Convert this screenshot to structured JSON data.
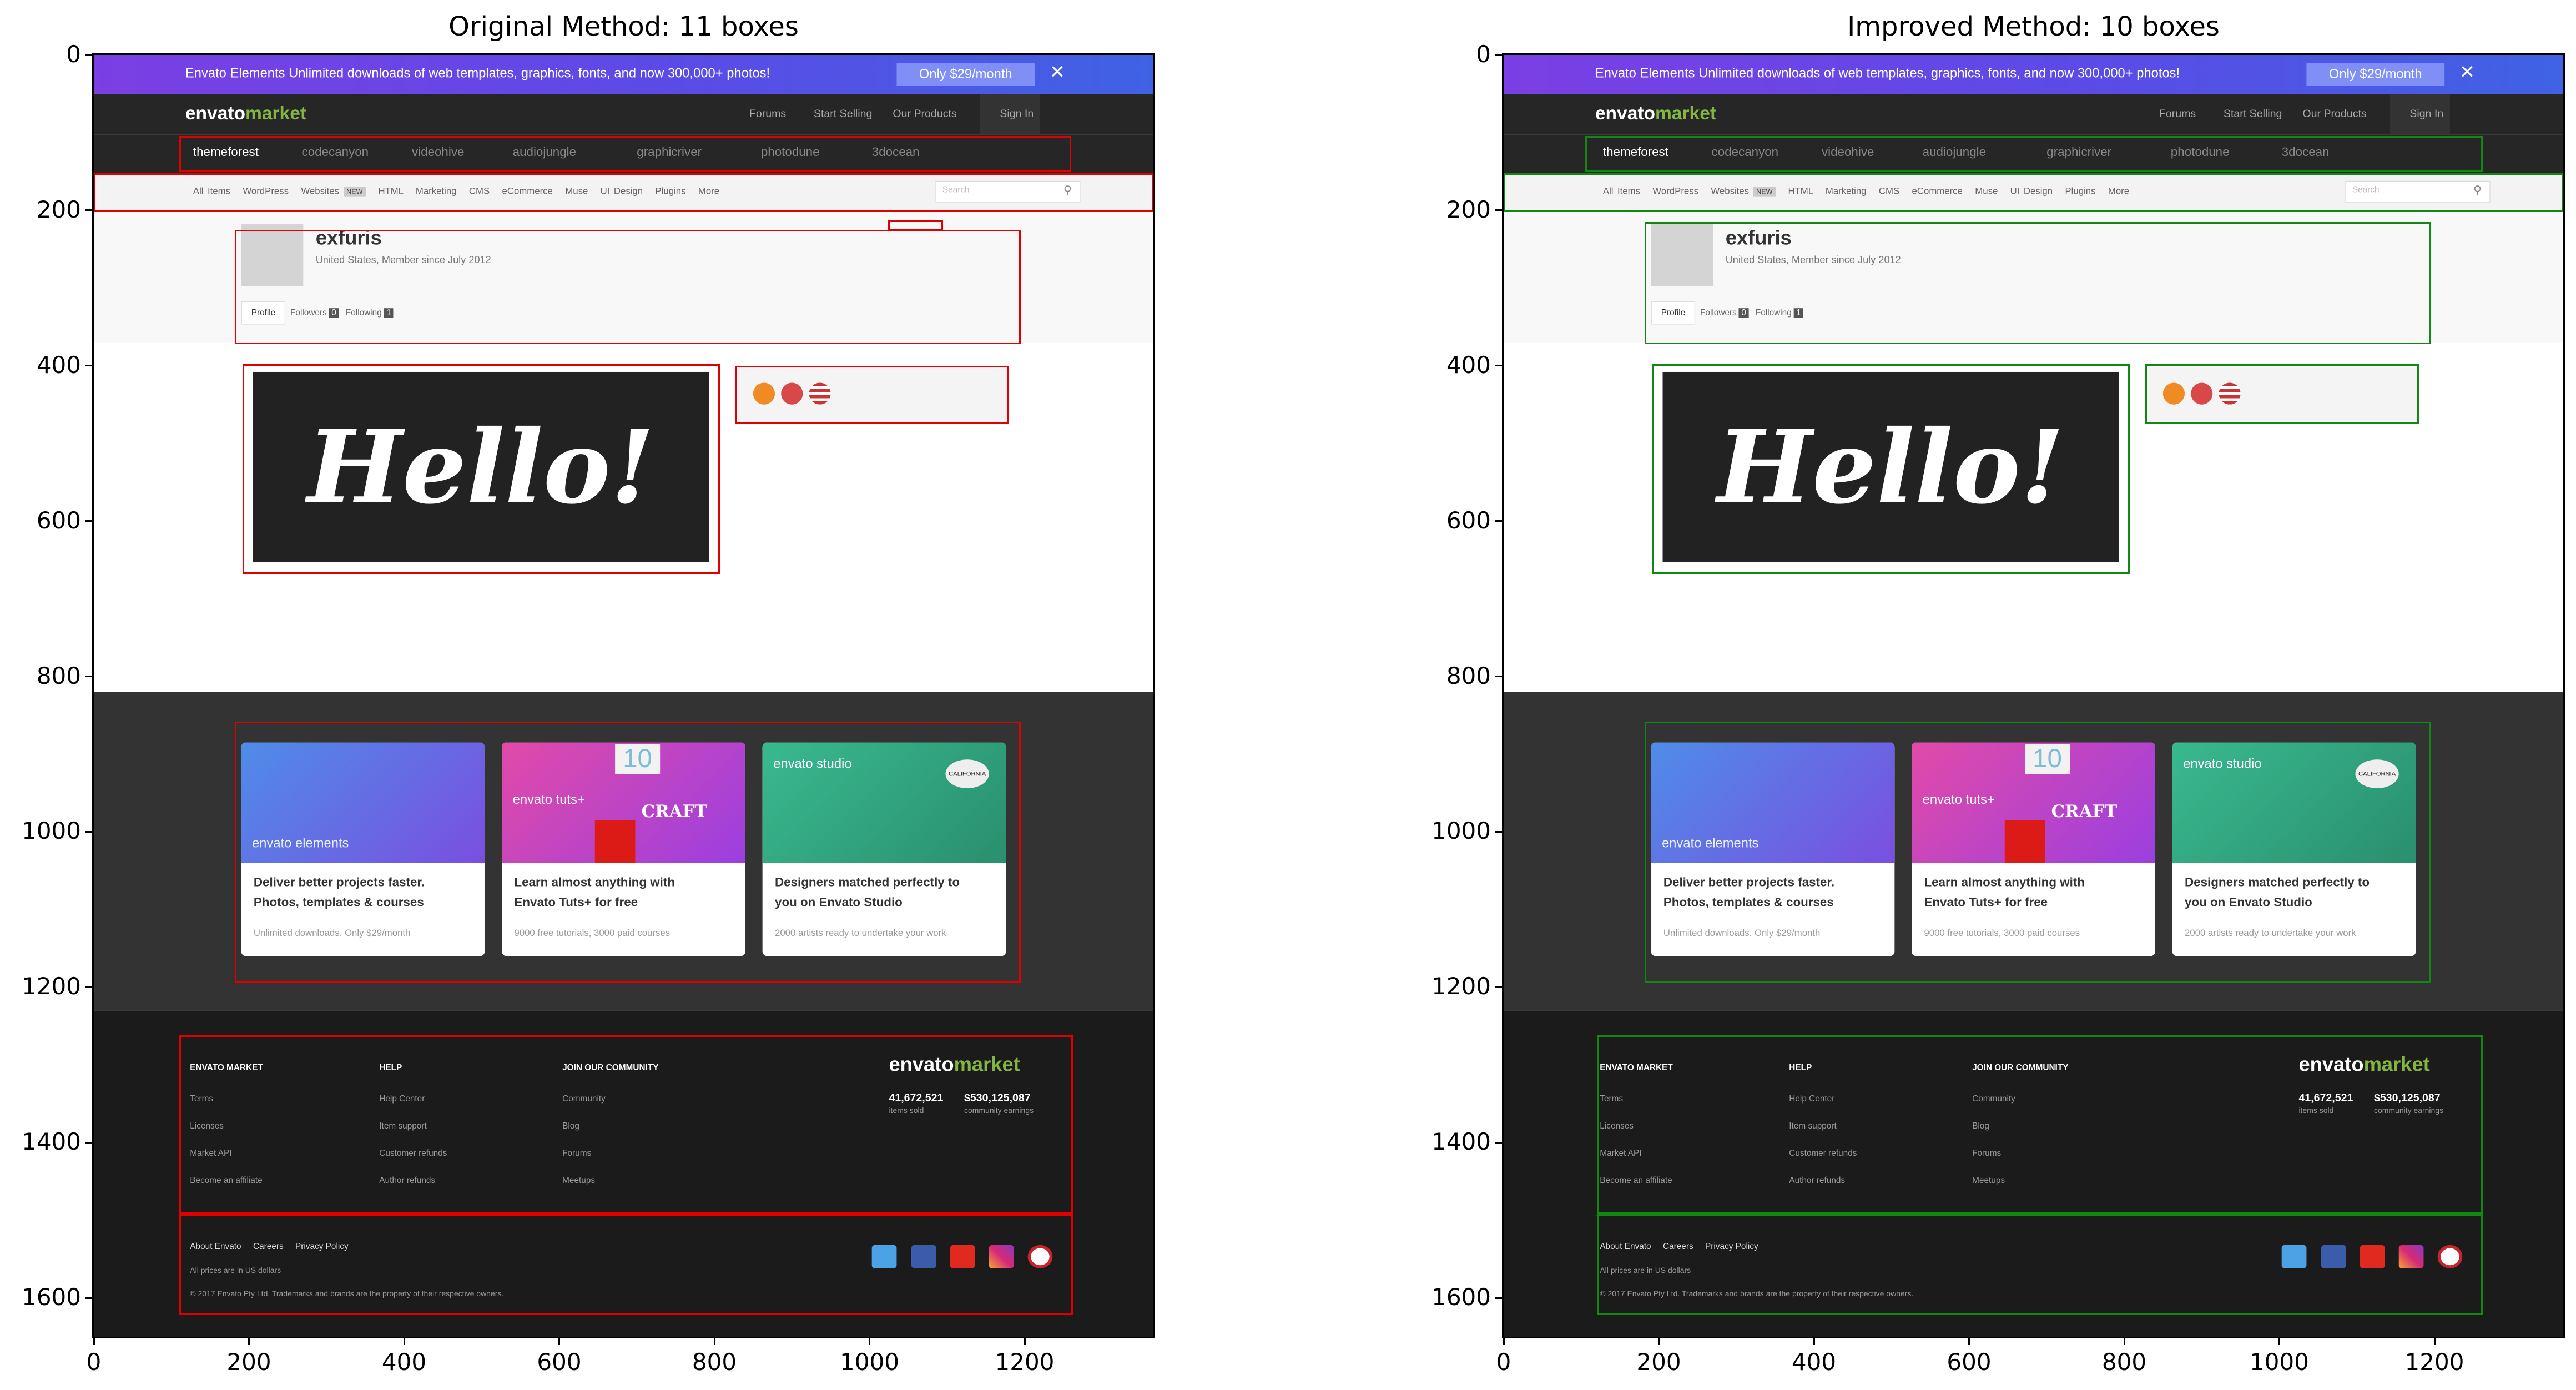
{
  "figure": {
    "panels": [
      {
        "title": "Original Method: 11 boxes",
        "box_color": "#e00000"
      },
      {
        "title": "Improved Method: 10 boxes",
        "box_color": "#118811"
      }
    ],
    "x_ticks": [
      "0",
      "200",
      "400",
      "600",
      "800",
      "1000",
      "1200"
    ],
    "y_ticks": [
      "0",
      "200",
      "400",
      "600",
      "800",
      "1000",
      "1200",
      "1400",
      "1600"
    ]
  },
  "chart_data": [
    {
      "type": "image-with-boxes",
      "title": "Original Method: 11 boxes",
      "xlim": [
        0,
        1366
      ],
      "ylim": [
        1650,
        0
      ],
      "boxes": [
        {
          "x0": 110,
          "y0": 104,
          "x1": 1260,
          "y1": 150
        },
        {
          "x0": 0,
          "y0": 152,
          "x1": 1366,
          "y1": 202
        },
        {
          "x0": 1024,
          "y0": 213,
          "x1": 1095,
          "y1": 226
        },
        {
          "x0": 182,
          "y0": 225,
          "x1": 1195,
          "y1": 372
        },
        {
          "x0": 192,
          "y0": 398,
          "x1": 807,
          "y1": 668
        },
        {
          "x0": 827,
          "y0": 400,
          "x1": 1180,
          "y1": 475
        },
        {
          "x0": 182,
          "y0": 858,
          "x1": 1195,
          "y1": 1195
        },
        {
          "x0": 110,
          "y0": 1262,
          "x1": 1262,
          "y1": 1492
        },
        {
          "x0": 110,
          "y0": 1492,
          "x1": 1262,
          "y1": 1622
        }
      ]
    },
    {
      "type": "image-with-boxes",
      "title": "Improved Method: 10 boxes",
      "xlim": [
        0,
        1366
      ],
      "ylim": [
        1650,
        0
      ],
      "boxes": [
        {
          "x0": 105,
          "y0": 104,
          "x1": 1262,
          "y1": 150
        },
        {
          "x0": 0,
          "y0": 152,
          "x1": 1366,
          "y1": 202
        },
        {
          "x0": 182,
          "y0": 215,
          "x1": 1195,
          "y1": 372
        },
        {
          "x0": 192,
          "y0": 398,
          "x1": 807,
          "y1": 668
        },
        {
          "x0": 827,
          "y0": 398,
          "x1": 1180,
          "y1": 475
        },
        {
          "x0": 182,
          "y0": 858,
          "x1": 1195,
          "y1": 1195
        },
        {
          "x0": 120,
          "y0": 1262,
          "x1": 1262,
          "y1": 1492
        },
        {
          "x0": 120,
          "y0": 1492,
          "x1": 1262,
          "y1": 1622
        }
      ]
    }
  ],
  "screenshot": {
    "promo_text": "Envato Elements Unlimited downloads of web templates, graphics, fonts, and now 300,000+ photos!",
    "promo_button": "Only $29/month",
    "promo_close": "✕",
    "logo_word": "envato",
    "logo_suffix": "market",
    "top_links": [
      "Forums",
      "Start Selling",
      "Our Products",
      "Sign In"
    ],
    "marketplaces": [
      "themeforest",
      "codecanyon",
      "videohive",
      "audiojungle",
      "graphicriver",
      "photodune",
      "3docean"
    ],
    "subnav": [
      "All Items",
      "WordPress",
      "Websites",
      "NEW",
      "HTML",
      "Marketing",
      "CMS",
      "eCommerce",
      "Muse",
      "UI Design",
      "Plugins",
      "More"
    ],
    "search_placeholder": "Search",
    "username": "exfuris",
    "user_meta": "United States, Member since July 2012",
    "profile_tabs": [
      "Profile",
      "Followers",
      "0",
      "Following",
      "1"
    ],
    "hello_text": "Hello!",
    "cards": [
      {
        "brand": "envato elements",
        "title1": "Deliver better projects faster.",
        "title2": "Photos, templates & courses",
        "sub": "Unlimited downloads. Only $29/month",
        "bg": "#5a6fe0"
      },
      {
        "brand": "envato tuts+",
        "title1": "Learn almost anything with",
        "title2": "Envato Tuts+ for free",
        "sub": "9000 free tutorials, 3000 paid courses",
        "bg": "#c93fc8"
      },
      {
        "brand": "envato studio",
        "title1": "Designers matched perfectly to",
        "title2": "you on Envato Studio",
        "sub": "2000 artists ready to undertake your work",
        "bg": "#3fb58c"
      }
    ],
    "card_overlays": [
      "10",
      "CRAFT",
      "CALIFORNIA"
    ],
    "footer_heads": [
      "ENVATO MARKET",
      "HELP",
      "JOIN OUR COMMUNITY"
    ],
    "footer_col1": [
      "Terms",
      "Licenses",
      "Market API",
      "Become an affiliate"
    ],
    "footer_col2": [
      "Help Center",
      "Item support",
      "Customer refunds",
      "Author refunds"
    ],
    "footer_col3": [
      "Community",
      "Blog",
      "Forums",
      "Meetups"
    ],
    "stat1_value": "41,672,521",
    "stat1_label": "items sold",
    "stat2_value": "$530,125,087",
    "stat2_label": "community earnings",
    "bottom_links": [
      "About Envato",
      "Careers",
      "Privacy Policy"
    ],
    "currency_note": "All prices are in US dollars",
    "copyright": "© 2017 Envato Pty Ltd. Trademarks and brands are the property of their respective owners."
  }
}
